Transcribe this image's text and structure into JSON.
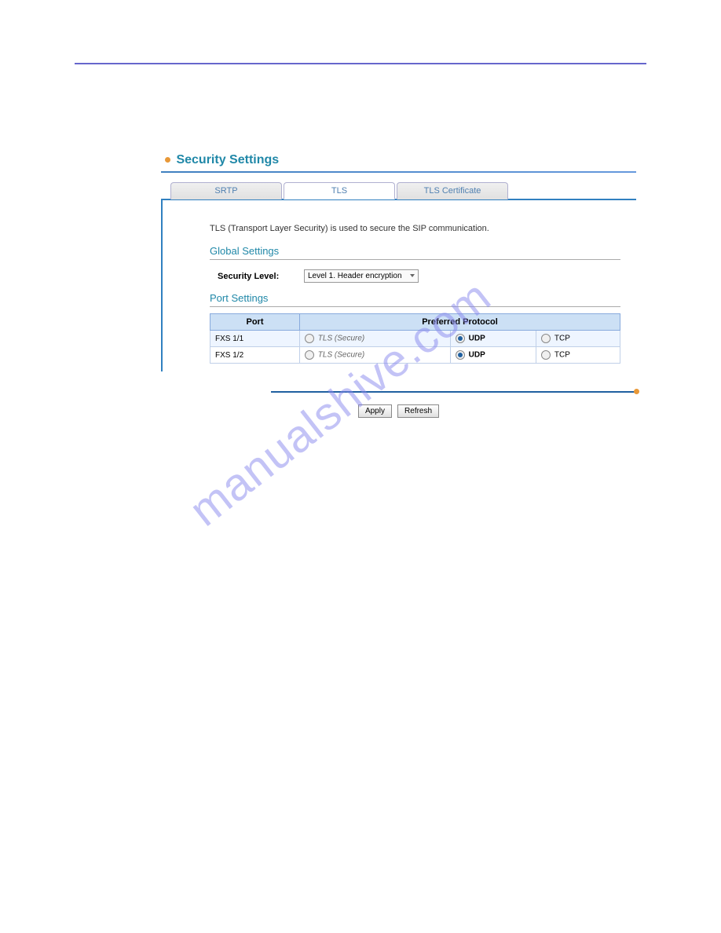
{
  "page_title": "Security Settings",
  "tabs": {
    "srtp": "SRTP",
    "tls": "TLS",
    "cert": "TLS Certificate"
  },
  "description": "TLS (Transport Layer Security) is used to secure the SIP communication.",
  "global_settings": {
    "heading": "Global Settings",
    "label": "Security Level:",
    "value": "Level 1. Header encryption"
  },
  "port_settings": {
    "heading": "Port Settings",
    "headers": {
      "port": "Port",
      "protocol": "Preferred Protocol"
    },
    "options": {
      "tls": "TLS (Secure)",
      "udp": "UDP",
      "tcp": "TCP"
    },
    "rows": [
      {
        "port": "FXS 1/1",
        "selected": "udp"
      },
      {
        "port": "FXS 1/2",
        "selected": "udp"
      }
    ]
  },
  "buttons": {
    "apply": "Apply",
    "refresh": "Refresh"
  },
  "watermark": "manualshive.com"
}
